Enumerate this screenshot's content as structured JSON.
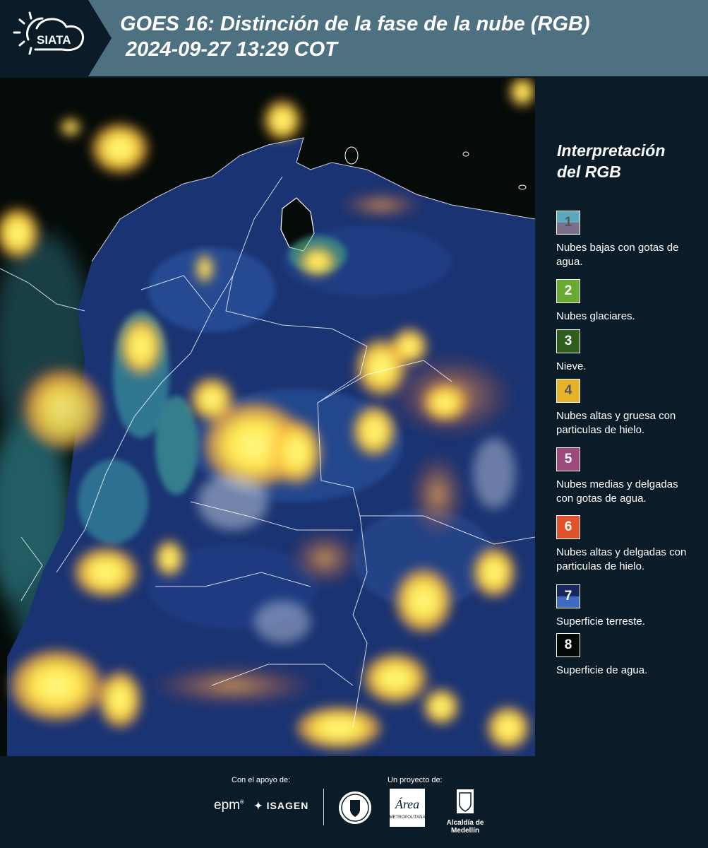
{
  "header": {
    "logo_text": "SIATA",
    "title_line1": "GOES 16: Distinción de la fase de la nube (RGB)",
    "title_line2": "2024-09-27 13:29 COT"
  },
  "legend": {
    "title_line1": "Interpretación",
    "title_line2": "del RGB",
    "items": [
      {
        "number": "1",
        "label": "Nubes bajas con gotas de agua.",
        "color_top": "#5aa9be",
        "color_bottom": "#7a6f8c",
        "number_color": "#555555"
      },
      {
        "number": "2",
        "label": "Nubes glaciares.",
        "color_top": "#6aa834",
        "color_bottom": "#6aa834",
        "number_color": "#ffffff"
      },
      {
        "number": "3",
        "label": "Nieve.",
        "color_top": "#2f5d1c",
        "color_bottom": "#2f5d1c",
        "number_color": "#ffffff"
      },
      {
        "number": "4",
        "label": "Nubes altas y gruesa con particulas de hielo.",
        "color_top": "#e5b22a",
        "color_bottom": "#e5b22a",
        "number_color": "#555555"
      },
      {
        "number": "5",
        "label": "Nubes medias y delgadas con gotas de agua.",
        "color_top": "#9c4a7c",
        "color_bottom": "#9c4a7c",
        "number_color": "#ffffff"
      },
      {
        "number": "6",
        "label": "Nubes altas y delgadas con particulas de hielo.",
        "color_top": "#e0522c",
        "color_bottom": "#e0522c",
        "number_color": "#ffffff"
      },
      {
        "number": "7",
        "label": "Superficie terreste.",
        "color_top": "#16285e",
        "color_bottom": "#3e6bc1",
        "number_color": "#ffffff"
      },
      {
        "number": "8",
        "label": "Superficie de agua.",
        "color_top": "#030a06",
        "color_bottom": "#030a06",
        "number_color": "#ffffff"
      }
    ]
  },
  "footer": {
    "support_label": "Con el apoyo de:",
    "project_label": "Un proyecto de:",
    "epm": "epm",
    "isagen": "ISAGEN",
    "area_text": "Área",
    "area_subtext": "METROPOLITANA",
    "medellin": "Alcaldía de Medellín"
  },
  "colors": {
    "header_bg": "#4d7180",
    "page_bg": "#0b1c28",
    "cloud_yellow": "#ffe85a",
    "land_blue": "#1b3a78",
    "water": "#050b08"
  }
}
